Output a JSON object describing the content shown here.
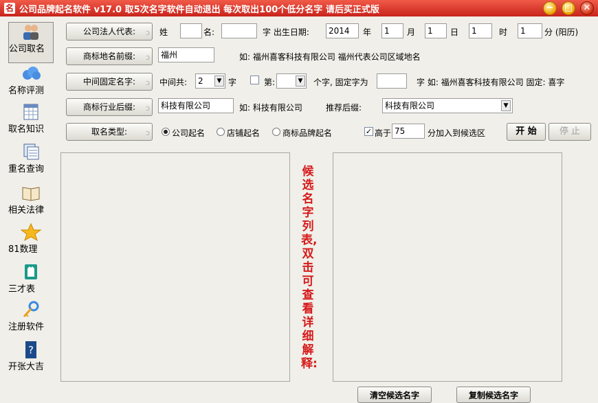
{
  "app": {
    "title": "公司品牌起名软件 v17.0  取5次名字软件自动退出  每次取出100个低分名字  请后买正式版"
  },
  "window_controls": {
    "minimize": "−",
    "maximize": "□",
    "close": "✕"
  },
  "sidebar": {
    "items": [
      {
        "label": "公司取名",
        "icon": "people-icon"
      },
      {
        "label": "名称评测",
        "icon": "cloud-icon"
      },
      {
        "label": "取名知识",
        "icon": "grid-icon"
      },
      {
        "label": "重名查询",
        "icon": "documents-icon"
      },
      {
        "label": "相关法律",
        "icon": "book-icon"
      },
      {
        "label": "81数理",
        "icon": "star-icon"
      },
      {
        "label": "三才表",
        "icon": "shirt-icon"
      },
      {
        "label": "注册软件",
        "icon": "key-icon"
      },
      {
        "label": "开张大吉",
        "icon": "help-icon"
      }
    ]
  },
  "form": {
    "legal_rep_button": "公司法人代表:",
    "surname_label": "姓",
    "surname_value": "",
    "name_label": "名:",
    "name_value": "",
    "char_birth_label": "字  出生日期:",
    "year_value": "2014",
    "year_label": "年",
    "month_value": "1",
    "month_label": "月",
    "day_value": "1",
    "day_label": "日",
    "hour_value": "1",
    "hour_label": "时",
    "minute_value": "1",
    "minute_label": "分 (阳历)",
    "prefix_button": "商标地名前缀:",
    "prefix_value": "福州",
    "prefix_hint": "如: 福州喜客科技有限公司   福州代表公司区域地名",
    "middle_button": "中间固定名字:",
    "middle_total_label": "中间共:",
    "middle_total_value": "2",
    "middle_char_label": "字",
    "middle_pos_label": "第:",
    "middle_pos_value": "",
    "middle_fixed_label": "个字, 固定字为",
    "middle_fixed_value": "",
    "middle_hint": "字  如: 福州喜客科技有限公司  固定: 喜字",
    "suffix_button": "商标行业后缀:",
    "suffix_value": "科技有限公司",
    "suffix_hint": "如: 科技有限公司",
    "recommend_label": "推荐后缀:",
    "recommend_value": "科技有限公司",
    "type_button": "取名类型:",
    "type_options": [
      "公司起名",
      "店铺起名",
      "商标品牌起名"
    ],
    "type_selected": "公司起名",
    "above_label": "高于",
    "above_checked": true,
    "above_value": "75",
    "above_suffix": "分加入到候选区",
    "start_button": "开  始",
    "stop_button": "停  止"
  },
  "candidate_hint": "候选名字列表,双击可查看详细解释:",
  "actions": {
    "clear_button": "清空候选名字",
    "copy_button": "复制候选名字"
  },
  "colors": {
    "titlebar": "#d8302a",
    "hint_text": "#d61a1a",
    "window_bg": "#f0efe9"
  }
}
